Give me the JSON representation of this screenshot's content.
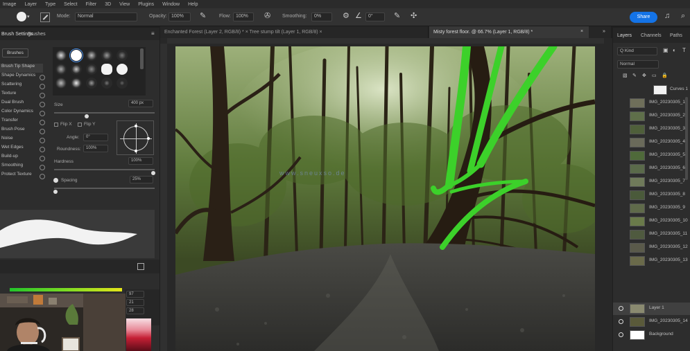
{
  "menu": [
    "Image",
    "Layer",
    "Type",
    "Select",
    "Filter",
    "3D",
    "View",
    "Plugins",
    "Window",
    "Help"
  ],
  "options_bar": {
    "mode_label": "Mode:",
    "mode_value": "Normal",
    "opacity_label": "Opacity:",
    "opacity_value": "100%",
    "flow_label": "Flow:",
    "flow_value": "100%",
    "smoothing_label": "Smoothing:",
    "smoothing_value": "0%",
    "angle_value": "0°",
    "share_label": "Share"
  },
  "left_panel": {
    "tabs": [
      "Brush Settings",
      "Brushes"
    ],
    "brush_tip_button": "Brushes",
    "settings": [
      "Brush Tip Shape",
      "Shape Dynamics",
      "Scattering",
      "Texture",
      "Dual Brush",
      "Color Dynamics",
      "Transfer",
      "Brush Pose",
      "Noise",
      "Wet Edges",
      "Build-up",
      "Smoothing",
      "Protect Texture"
    ],
    "size_label": "Size",
    "size_value": "400 px",
    "flip_x": "Flip X",
    "flip_y": "Flip Y",
    "angle_label": "Angle:",
    "angle_value": "0°",
    "roundness_label": "Roundness:",
    "roundness_value": "100%",
    "hardness_label": "Hardness",
    "hardness_value": "100%",
    "spacing_label": "Spacing",
    "spacing_value": "25%",
    "color_values": [
      "97",
      "21",
      "28"
    ]
  },
  "document_tabs": [
    {
      "title": "Enchanted Forest (Layer 2, RGB/8) * × Tree stump tilt (Layer 1, RGB/8) ×",
      "active": false
    },
    {
      "title": "Misty forest floor. @ 66.7% (Layer 1, RGB/8) *",
      "active": true
    }
  ],
  "watermark": "www.sneuxso.de",
  "right_panel": {
    "tabs": [
      "Layers",
      "Channels",
      "Paths"
    ],
    "filter_value": "Q Kind",
    "blend_value": "Normal",
    "layers": [
      {
        "name": "Curves 1",
        "visible": false,
        "thumb": "#f2f2f2"
      },
      {
        "name": "IMG_20230305_1",
        "visible": false,
        "thumb": "#6f6f5a"
      },
      {
        "name": "IMG_20230305_2",
        "visible": false,
        "thumb": "#5f6f4a"
      },
      {
        "name": "IMG_20230305_3",
        "visible": false,
        "thumb": "#4f5f3a"
      },
      {
        "name": "IMG_20230305_4",
        "visible": false,
        "thumb": "#6a6a5a"
      },
      {
        "name": "IMG_20230305_5",
        "visible": false,
        "thumb": "#4f6a3a"
      },
      {
        "name": "IMG_20230305_6",
        "visible": false,
        "thumb": "#5a6a4a"
      },
      {
        "name": "IMG_20230305_7",
        "visible": false,
        "thumb": "#6f7a5a"
      },
      {
        "name": "IMG_20230305_8",
        "visible": false,
        "thumb": "#4a5a3a"
      },
      {
        "name": "IMG_20230305_9",
        "visible": false,
        "thumb": "#5f6a4a"
      },
      {
        "name": "IMG_20230305_10",
        "visible": false,
        "thumb": "#6a7a4a"
      },
      {
        "name": "IMG_20230305_11",
        "visible": false,
        "thumb": "#4f5a3f"
      },
      {
        "name": "IMG_20230305_12",
        "visible": false,
        "thumb": "#5a5a4a"
      },
      {
        "name": "IMG_20230305_13",
        "visible": false,
        "thumb": "#6a6a4a"
      },
      {
        "name": "Layer 1",
        "visible": true,
        "thumb": "#8a8a70",
        "selected": true
      },
      {
        "name": "IMG_20230305_14",
        "visible": true,
        "thumb": "#5a5a3a"
      },
      {
        "name": "Background",
        "visible": true,
        "thumb": "#ffffff"
      }
    ]
  },
  "colors": {
    "accent": "#1473e6",
    "stroke": "#3cd12a",
    "panel": "#2d2d2d"
  }
}
